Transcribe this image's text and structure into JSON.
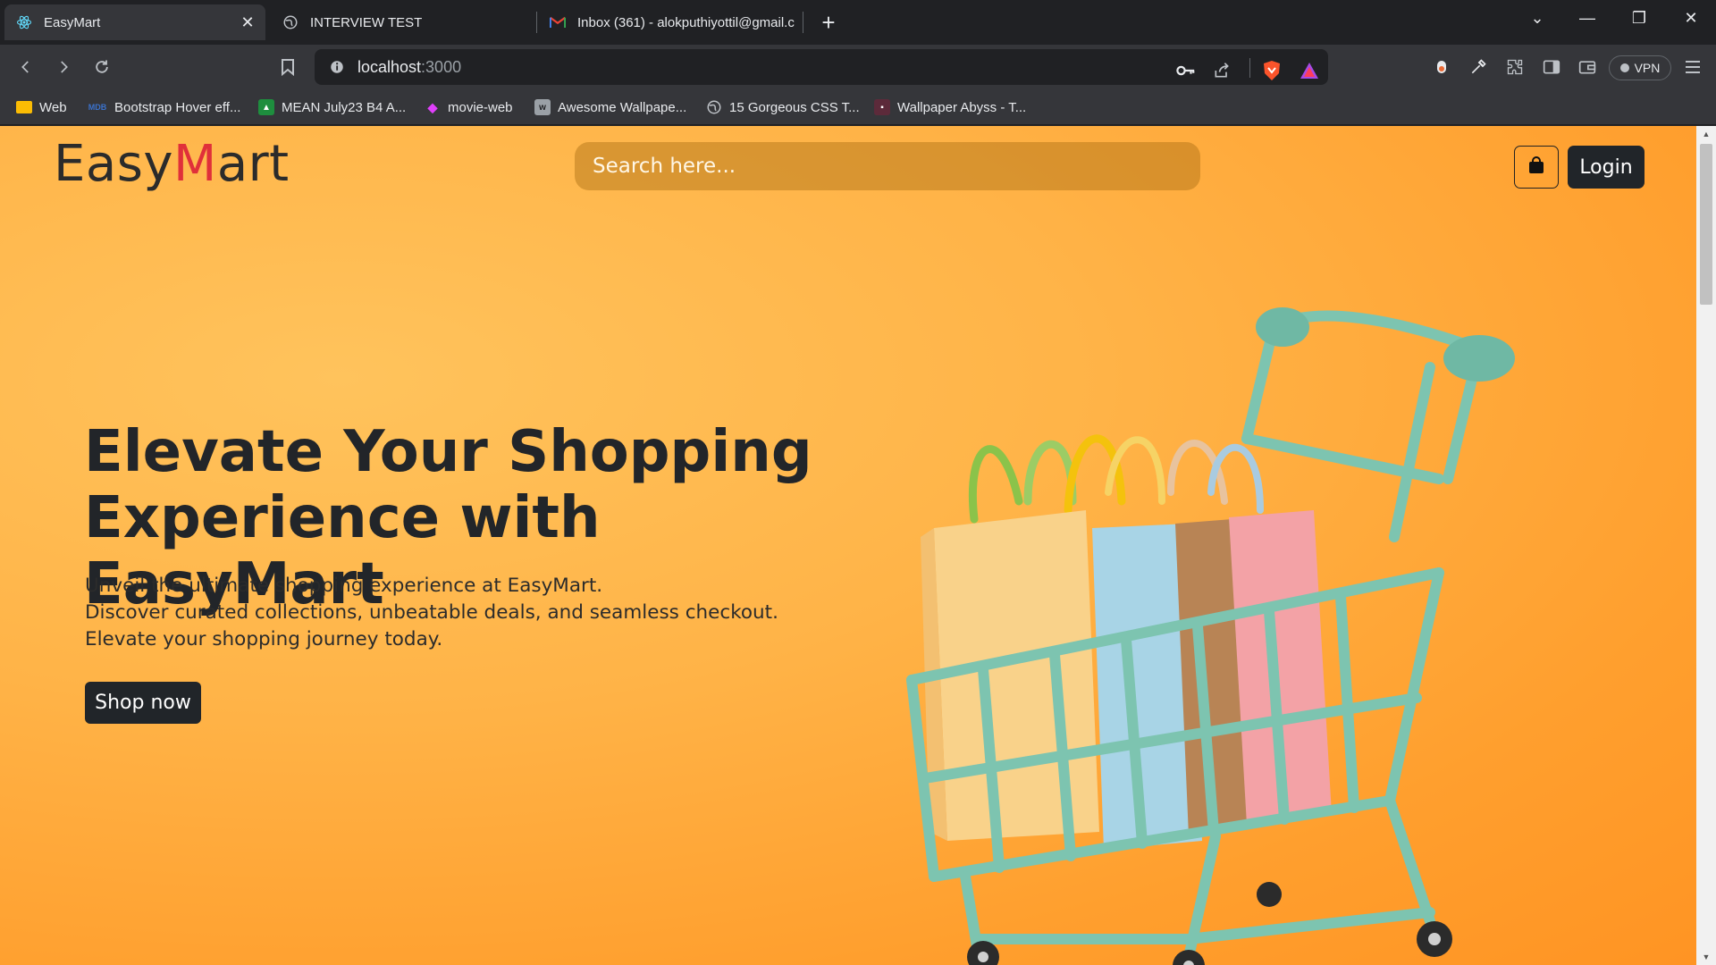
{
  "browser": {
    "tabs": [
      {
        "title": "EasyMart",
        "icon": "react-icon",
        "active": true
      },
      {
        "title": "INTERVIEW TEST",
        "icon": "globe-icon",
        "active": false
      },
      {
        "title": "Inbox (361) - alokputhiyottil@gmail.c",
        "icon": "gmail-icon",
        "active": false
      }
    ],
    "address": {
      "host": "localhost",
      "port": ":3000"
    },
    "vpn_label": "VPN",
    "bookmarks": [
      {
        "label": "Web",
        "icon": "folder-icon"
      },
      {
        "label": "Bootstrap Hover eff...",
        "icon": "mdb-icon"
      },
      {
        "label": "MEAN July23 B4 A...",
        "icon": "classroom-icon"
      },
      {
        "label": "movie-web",
        "icon": "diamond-icon"
      },
      {
        "label": "Awesome Wallpape...",
        "icon": "wallpaper-icon"
      },
      {
        "label": "15 Gorgeous CSS T...",
        "icon": "globe-icon"
      },
      {
        "label": "Wallpaper Abyss - T...",
        "icon": "abyss-icon"
      }
    ]
  },
  "site": {
    "logo_prefix": "Easy",
    "logo_m": "M",
    "logo_suffix": "art",
    "search_placeholder": "Search here...",
    "login_label": "Login",
    "hero": {
      "title_line1": "Elevate Your Shopping",
      "title_line2": "Experience with EasyMart",
      "desc_line1": "Unveil the ultimate shopping experience at EasyMart.",
      "desc_line2": "Discover curated collections, unbeatable deals, and seamless checkout.",
      "desc_line3": "Elevate your shopping journey today.",
      "cta_label": "Shop now"
    }
  },
  "colors": {
    "accent_red": "#e0303a",
    "dark_button": "#212529",
    "hero_orange": "#ffb347"
  }
}
